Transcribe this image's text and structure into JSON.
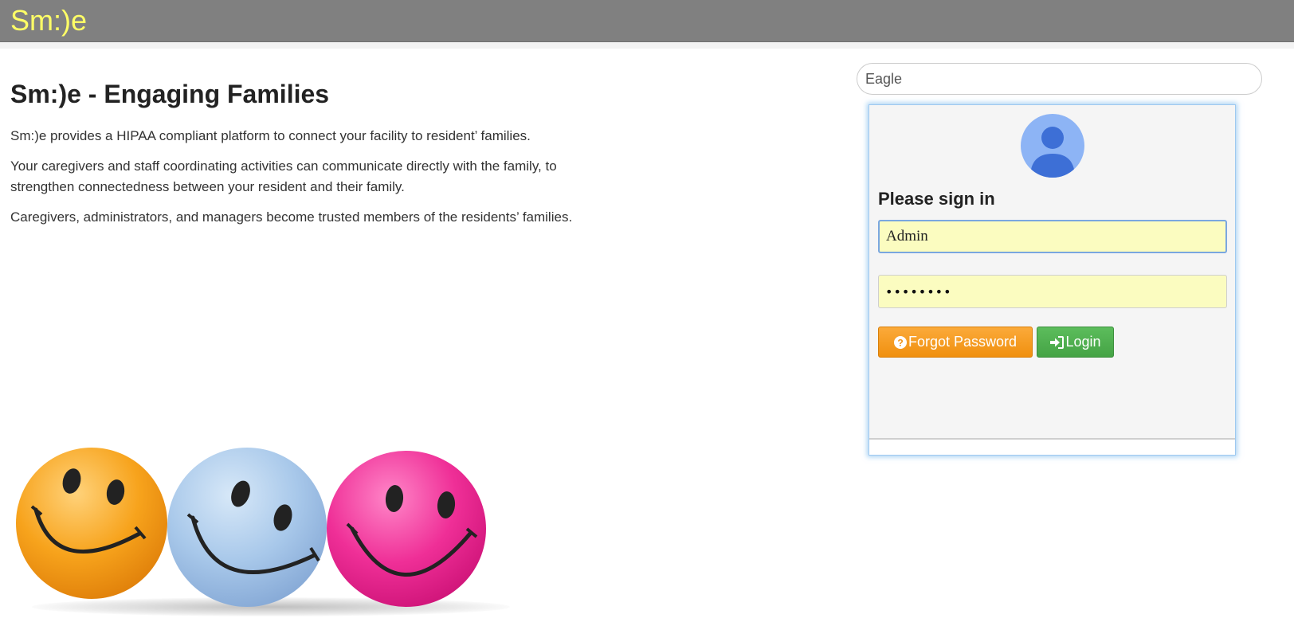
{
  "header": {
    "brand": "Sm:)e",
    "brand_color": "#ffff66",
    "bar_color": "#808080"
  },
  "intro": {
    "title": "Sm:)e - Engaging Families",
    "paragraphs": [
      "Sm:)e provides a HIPAA compliant platform to connect your facility to resident’ families.",
      "Your caregivers and staff coordinating activities can communicate directly with the family, to strengthen connectedness between your resident and their family.",
      "Caregivers, administrators, and managers become trusted members of the residents’ families."
    ]
  },
  "hero_image": {
    "icon": "smiley-balls",
    "balls": [
      "orange",
      "blue",
      "pink"
    ]
  },
  "facility_search": {
    "value": "Eagle"
  },
  "login": {
    "avatar_icon": "user-avatar-icon",
    "title": "Please sign in",
    "username_value": "Admin",
    "password_value": "••••••••",
    "forgot_label": "Forgot Password",
    "forgot_icon": "question-circle-icon",
    "login_label": "Login",
    "login_icon": "sign-in-icon",
    "forgot_color": "#f7941d",
    "login_color": "#4cae4c"
  }
}
